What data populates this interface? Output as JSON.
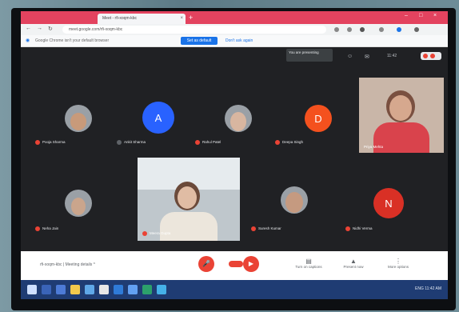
{
  "browser": {
    "tab_title": "Meet - rfi-xoqm-kbc",
    "tab_close": "×",
    "new_tab": "+",
    "window_controls": [
      "–",
      "□",
      "×"
    ],
    "url": "meet.google.com/rfi-xoqm-kbc",
    "infobar_text": "Google Chrome isn't your default browser",
    "infobar_button": "Set as default",
    "infobar_link": "Don't ask again"
  },
  "meet": {
    "present_pill": "You are presenting",
    "top_icons": [
      "people-icon",
      "chat-icon"
    ],
    "participants": [
      {
        "name": "Pooja Sharma",
        "initial": "",
        "color": "#3c4043",
        "photo": true
      },
      {
        "name": "Ankit Sharma",
        "initial": "A",
        "color": "#2962ff",
        "photo": false
      },
      {
        "name": "Rahul Patel",
        "initial": "",
        "color": "#3c4043",
        "photo": true
      },
      {
        "name": "Deepa Singh",
        "initial": "D",
        "color": "#f4511e",
        "photo": false
      },
      {
        "name": "Neha Jain",
        "initial": "",
        "color": "#3c4043",
        "photo": true
      },
      {
        "name": "Suresh Kumar",
        "initial": "",
        "color": "#3c4043",
        "photo": true
      },
      {
        "name": "Nidhi Verma",
        "initial": "N",
        "color": "#d93025",
        "photo": false
      }
    ],
    "video_name": "Meera Gupta",
    "self_name": "Priya Mehta"
  },
  "controls": {
    "meeting_code": "rfi-xoqm-kbc  |  Meeting details ^",
    "mic_label": "Turn on microphone",
    "cam_label": "Turn on camera",
    "ctrl_captions": "Turn on captions",
    "ctrl_present": "Present now",
    "ctrl_more": "More options"
  },
  "taskbar": {
    "tray_text": "ENG  11:42 AM"
  }
}
